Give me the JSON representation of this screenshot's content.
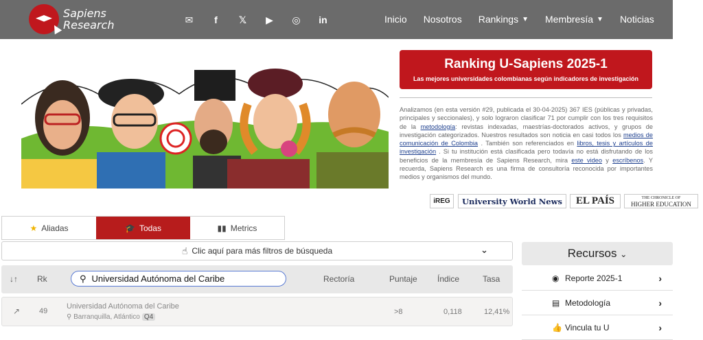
{
  "brand": {
    "line1": "Sapiens",
    "line2": "Research"
  },
  "socials": [
    {
      "icon": "mail-icon",
      "glyph": "✉"
    },
    {
      "icon": "facebook-icon",
      "glyph": "f"
    },
    {
      "icon": "x-icon",
      "glyph": "𝕏"
    },
    {
      "icon": "youtube-icon",
      "glyph": "▶"
    },
    {
      "icon": "instagram-icon",
      "glyph": "◎"
    },
    {
      "icon": "linkedin-icon",
      "glyph": "in"
    }
  ],
  "nav": [
    {
      "label": "Inicio"
    },
    {
      "label": "Nosotros"
    },
    {
      "label": "Rankings",
      "caret": "▼"
    },
    {
      "label": "Membresía",
      "caret": "▼"
    },
    {
      "label": "Noticias"
    }
  ],
  "ranking": {
    "title": "Ranking U-Sapiens 2025-1",
    "subtitle": "Las mejores universidades colombianas según indicadores de investigación"
  },
  "description": {
    "p1": "Analizamos (en esta versión #29, publicada el 30-04-2025) 367 IES (públicas y privadas, principales y seccionales), y solo lograron clasificar 71 por cumplir con los tres requisitos de la ",
    "link_metodologia": "metodología",
    "p2": ": revistas indexadas, maestrías-doctorados activos, y grupos de investigación categorizados. Nuestros resultados son noticia en casi todos los ",
    "link_medios": "medios de comunicación de Colombia",
    "p3": " . También son referenciados en ",
    "link_libros": "libros, tesis y artículos de investigación",
    "p4": " . Si tu institución está clasificada pero todavía no está disfrutando de los beneficios de la membresía de Sapiens Research, mira ",
    "link_video": "este video",
    "p5": " y ",
    "link_escribenos": "escríbenos",
    "p6": ". Y recuerda, Sapiens Research es una firma de consultoría reconocida por importantes medios y organismos del mundo."
  },
  "press": {
    "ireg": "iREG",
    "uwn": "University World News",
    "elpais": "EL PAÍS",
    "chronicle_top": "THE CHRONICLE OF",
    "chronicle_bottom": "HIGHER EDUCATION"
  },
  "tabs": [
    {
      "label": "Aliadas",
      "icon": "★"
    },
    {
      "label": "Todas",
      "icon": "🎓",
      "active": true
    },
    {
      "label": "Metrics",
      "icon": "▮▮"
    }
  ],
  "filters": {
    "label": "Clic aquí para más filtros de búsqueda",
    "chevron": "⌄"
  },
  "table": {
    "headers": {
      "sort": "↓↑",
      "rk": "Rk",
      "rectoria": "Rectoría",
      "puntaje": "Puntaje",
      "indice": "Índice",
      "tasa": "Tasa"
    },
    "search_value": "Universidad Autónoma del Caribe",
    "rows": [
      {
        "trend": "↗",
        "rank": "49",
        "name": "Universidad Autónoma del Caribe",
        "location": "Barranquilla, Atlántico",
        "quartile": "Q4",
        "puntaje": ">8",
        "indice": "0,118",
        "tasa": "12,41%"
      }
    ]
  },
  "resources": {
    "title": "Recursos",
    "items": [
      {
        "label": "Reporte 2025-1",
        "icon": "globe-icon"
      },
      {
        "label": "Metodología",
        "icon": "book-icon"
      },
      {
        "label": "Vincula tu U",
        "icon": "thumbs-up-icon"
      }
    ]
  }
}
